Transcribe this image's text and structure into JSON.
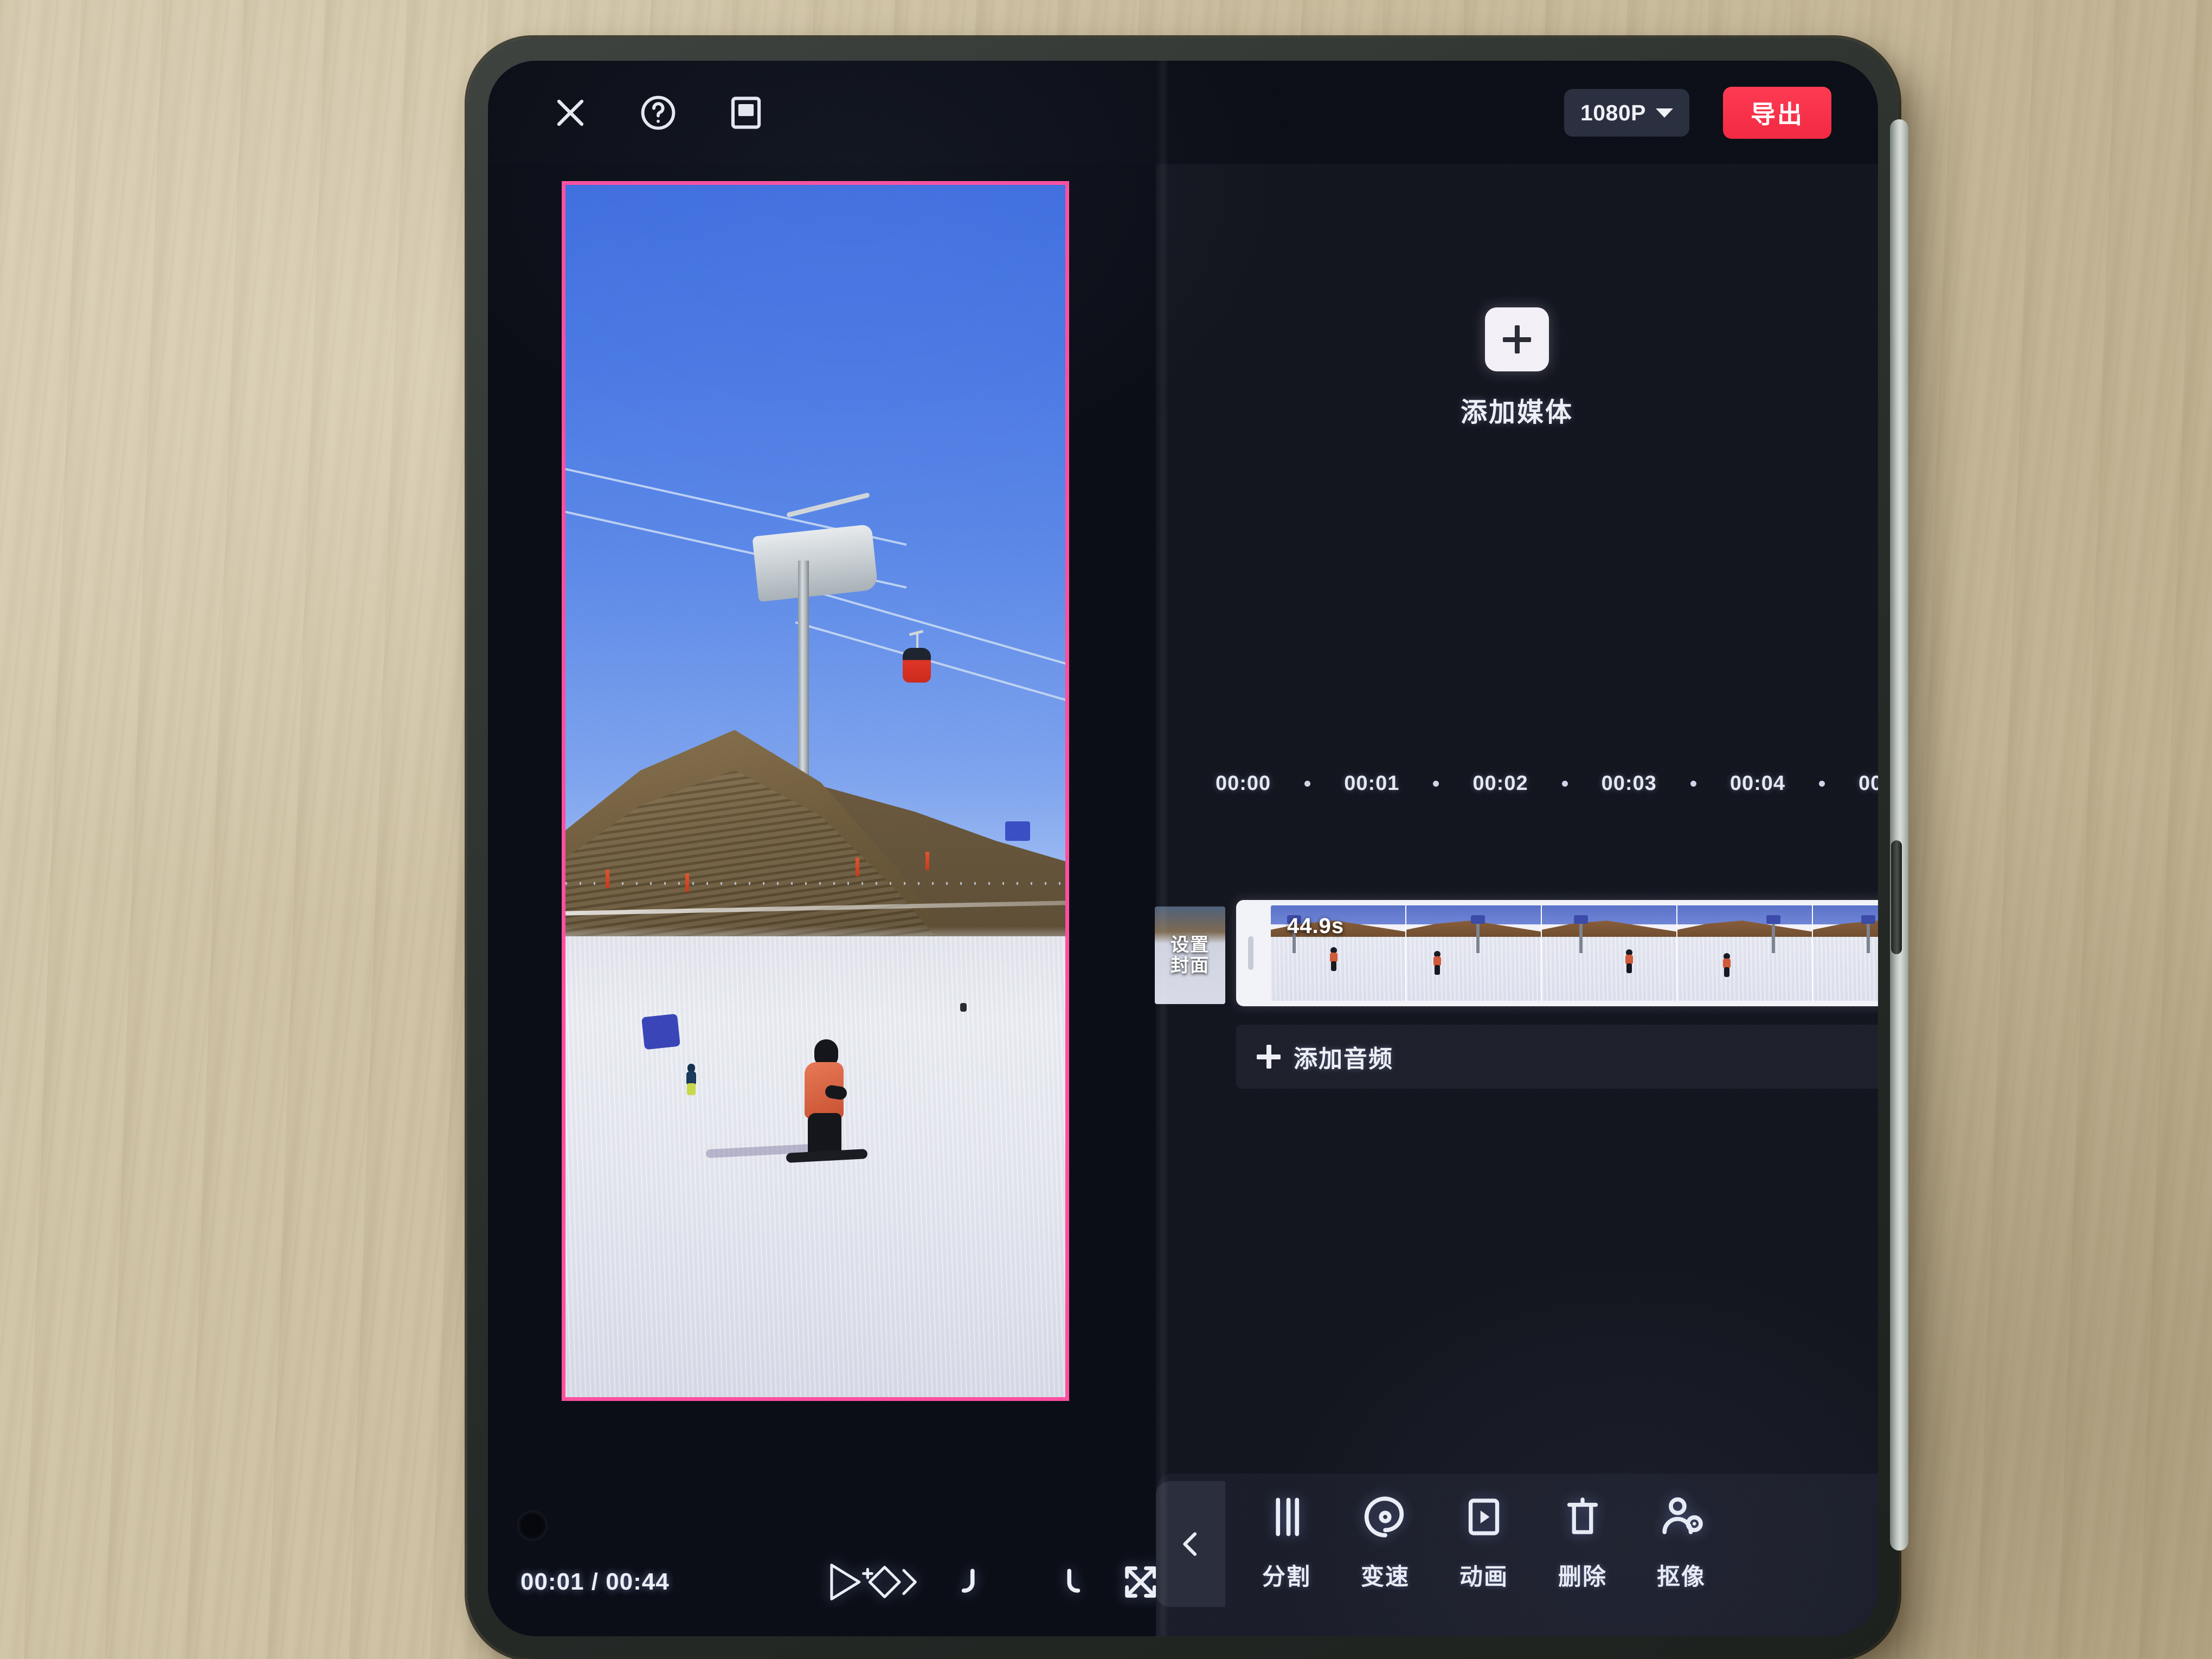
{
  "app": {
    "name": "video-editor",
    "accent_red": "#fe3b52",
    "selection_pink": "#ff4fa0",
    "panel_bg": "#14161f",
    "toolbar_bg": "#1b1e2a"
  },
  "topbar": {
    "close_icon": "close-icon",
    "help_icon": "help-circle-icon",
    "ratio_icon": "aspect-ratio-icon",
    "resolution": {
      "value": "1080P",
      "caret_icon": "chevron-down-icon"
    },
    "export_label": "导出"
  },
  "preview": {
    "selection_border_color": "#ff4fa0",
    "scene_description": "ski-resort-snowboarder"
  },
  "playback": {
    "current_time": "00:01",
    "separator": "/",
    "total_time": "00:44",
    "timecode": "00:01 / 00:44",
    "play_icon": "play-icon",
    "keyframe_icon": "add-keyframe-icon",
    "undo_icon": "undo-icon",
    "redo_icon": "redo-icon",
    "fullscreen_icon": "fullscreen-icon"
  },
  "media": {
    "add_icon": "plus-icon",
    "add_label": "添加媒体"
  },
  "ruler": {
    "labels": [
      "00:00",
      "00:01",
      "00:02",
      "00:03",
      "00:04",
      "00"
    ]
  },
  "timeline": {
    "cover_label_line1": "设置",
    "cover_label_line2": "封面",
    "clip_duration": "44.9s",
    "audio_add_icon": "plus-icon",
    "audio_add_label": "添加音频",
    "playhead_name": "playhead"
  },
  "toolbar": {
    "back_icon": "chevron-left-icon",
    "items": [
      {
        "icon": "split-icon",
        "label": "分割"
      },
      {
        "icon": "speed-icon",
        "label": "变速"
      },
      {
        "icon": "animation-icon",
        "label": "动画"
      },
      {
        "icon": "delete-icon",
        "label": "删除"
      },
      {
        "icon": "cutout-icon",
        "label": "抠像"
      }
    ]
  }
}
